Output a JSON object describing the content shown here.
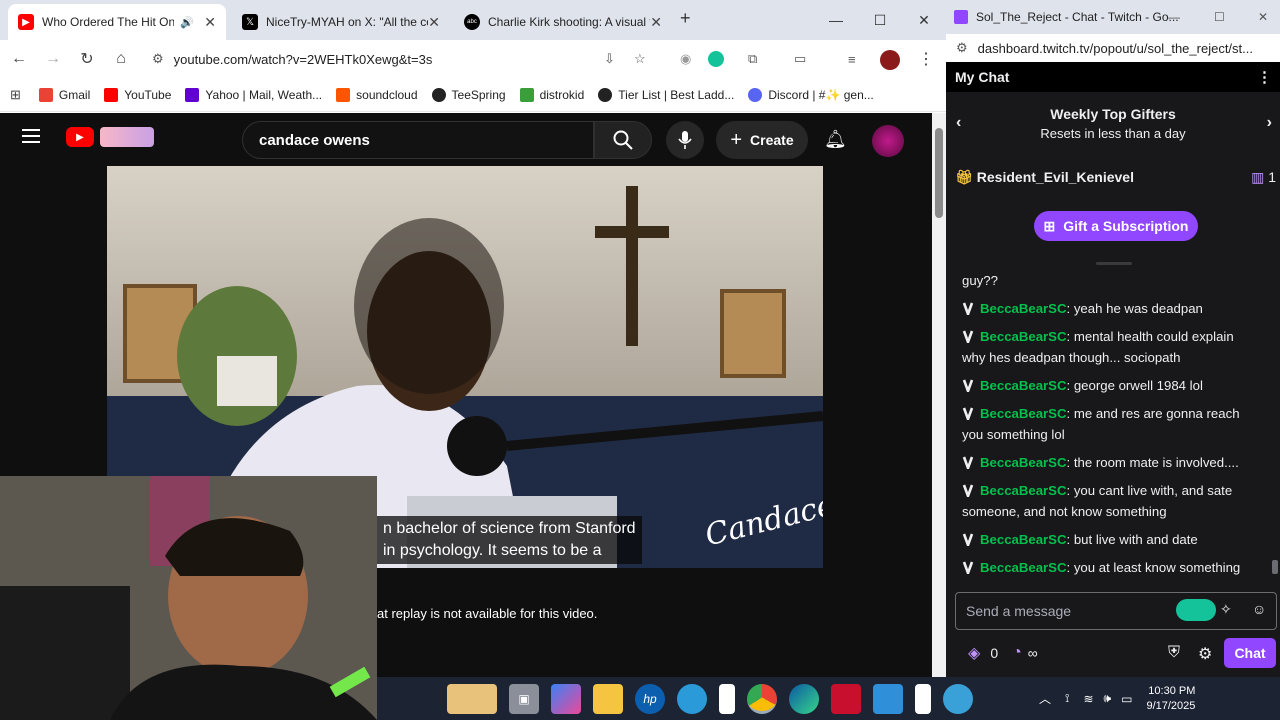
{
  "browser": {
    "tabs": [
      {
        "title": "Who Ordered The Hit On C",
        "active": true
      },
      {
        "title": "NiceTry-MYAH on X: \"All the co",
        "active": false
      },
      {
        "title": "Charlie Kirk shooting: A visual ti",
        "active": false
      }
    ],
    "url": "youtube.com/watch?v=2WEHTk0Xewg&t=3s",
    "bookmarks": [
      "Gmail",
      "YouTube",
      "Yahoo | Mail, Weath...",
      "soundcloud",
      "TeeSpring",
      "distrokid",
      "Tier List | Best Ladd...",
      "Discord | #✨ gen..."
    ]
  },
  "youtube": {
    "search_value": "candace owens",
    "create_label": "Create",
    "subtitle_line1": "n bachelor of science from Stanford",
    "subtitle_line2": "in psychology. It seems to be a",
    "watermark": "Candace",
    "chat_replay_notice": "at replay is not available for this video."
  },
  "twitch": {
    "window_title": "Sol_The_Reject - Chat - Twitch - Go...",
    "url": "dashboard.twitch.tv/popout/u/sol_the_reject/st...",
    "header": "My Chat",
    "gifters_title": "Weekly Top Gifters",
    "gifters_sub": "Resets in less than a day",
    "top_gifter": "Resident_Evil_Kenievel",
    "top_gifter_count": "1",
    "gift_button": "Gift a Subscription",
    "partial_message": "guy??",
    "messages": [
      {
        "user": "BeccaBearSC",
        "text": ": yeah he was deadpan"
      },
      {
        "user": "BeccaBearSC",
        "text": ": mental health could explain why hes deadpan though... sociopath"
      },
      {
        "user": "BeccaBearSC",
        "text": ": george orwell 1984 lol"
      },
      {
        "user": "BeccaBearSC",
        "text": ": me and res are gonna reach you something lol"
      },
      {
        "user": "BeccaBearSC",
        "text": ": the room mate is involved...."
      },
      {
        "user": "BeccaBearSC",
        "text": ": you cant live with, and sate someone, and not know something"
      },
      {
        "user": "BeccaBearSC",
        "text": ": but live with and date"
      },
      {
        "user": "BeccaBearSC",
        "text": ": you at least know something"
      }
    ],
    "input_placeholder": "Send a message",
    "points": "0",
    "infinity": "∞",
    "chat_button": "Chat",
    "username_color": "#00c14b",
    "accent": "#9147ff"
  },
  "taskbar": {
    "time": "10:30 PM",
    "date": "9/17/2025"
  }
}
